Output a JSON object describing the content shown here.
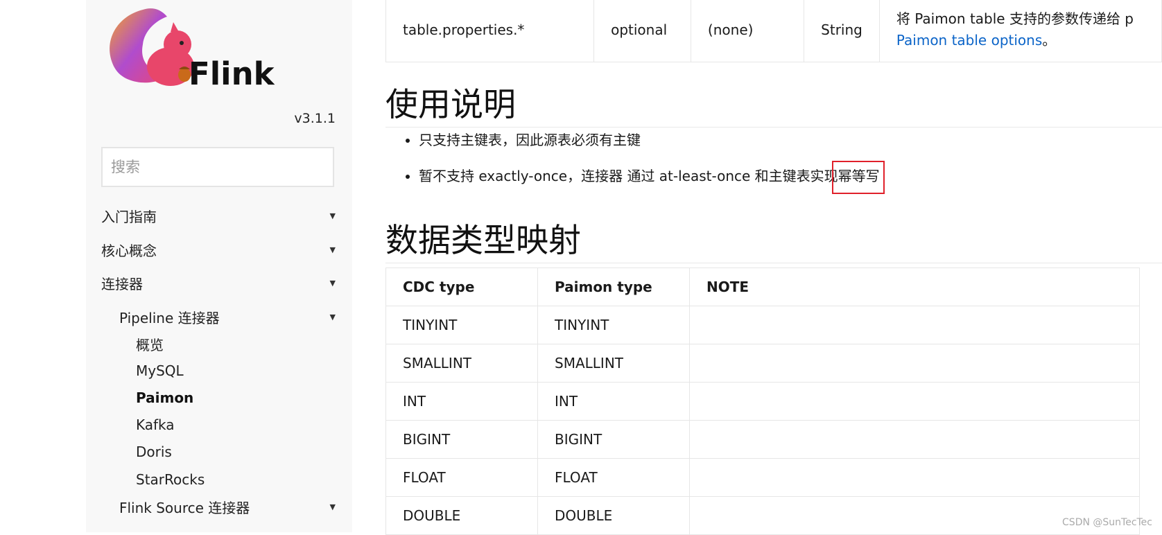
{
  "sidebar": {
    "brand": "Flink",
    "version": "v3.1.1",
    "search_placeholder": "搜索",
    "nav": [
      {
        "label": "入门指南",
        "arrow": "▼"
      },
      {
        "label": "核心概念",
        "arrow": "▼"
      },
      {
        "label": "连接器",
        "arrow": "▼"
      },
      {
        "label": "Pipeline 连接器",
        "arrow": "▼"
      },
      {
        "label": "概览"
      },
      {
        "label": "MySQL"
      },
      {
        "label": "Paimon"
      },
      {
        "label": "Kafka"
      },
      {
        "label": "Doris"
      },
      {
        "label": "StarRocks"
      },
      {
        "label": "Flink Source 连接器",
        "arrow": "▼"
      }
    ]
  },
  "options_row": {
    "key": "table.properties.*",
    "required": "optional",
    "default": "(none)",
    "type": "String",
    "desc_text": "将 Paimon table 支持的参数传递给 p",
    "desc_link": "Paimon table options",
    "desc_end": "。"
  },
  "usage": {
    "heading": "使用说明",
    "notes": [
      "只支持主键表，因此源表必须有主键",
      "暂不支持 exactly-once，连接器 通过 at-least-once 和主键表实现幂等写"
    ]
  },
  "type_mapping": {
    "heading": "数据类型映射",
    "headers": [
      "CDC type",
      "Paimon type",
      "NOTE"
    ],
    "rows": [
      [
        "TINYINT",
        "TINYINT",
        ""
      ],
      [
        "SMALLINT",
        "SMALLINT",
        ""
      ],
      [
        "INT",
        "INT",
        ""
      ],
      [
        "BIGINT",
        "BIGINT",
        ""
      ],
      [
        "FLOAT",
        "FLOAT",
        ""
      ],
      [
        "DOUBLE",
        "DOUBLE",
        ""
      ]
    ]
  },
  "watermark": "CSDN @SunTecTec",
  "colors": {
    "link": "#0b64c8",
    "highlight": "#e0202a",
    "sidebar_bg": "#f8f8f8"
  }
}
